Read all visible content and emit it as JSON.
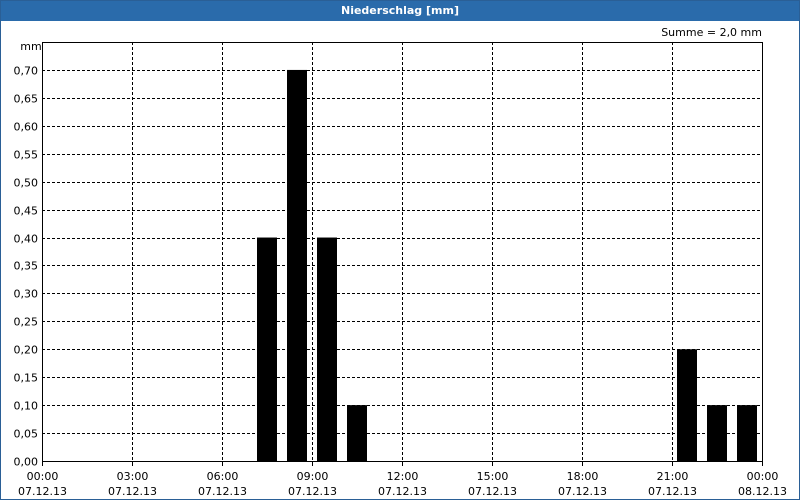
{
  "window": {
    "title": "Niederschlag [mm]"
  },
  "chart_data": {
    "type": "bar",
    "title": "Niederschlag [mm]",
    "ylabel": "mm",
    "sum_label": "Summe = 2,0 mm",
    "ylim": [
      0,
      0.75
    ],
    "y_ticks": [
      "0,00",
      "0,05",
      "0,10",
      "0,15",
      "0,20",
      "0,25",
      "0,30",
      "0,35",
      "0,40",
      "0,45",
      "0,50",
      "0,55",
      "0,60",
      "0,65",
      "0,70"
    ],
    "x_ticks": [
      {
        "time": "00:00",
        "date": "07.12.13"
      },
      {
        "time": "03:00",
        "date": "07.12.13"
      },
      {
        "time": "06:00",
        "date": "07.12.13"
      },
      {
        "time": "09:00",
        "date": "07.12.13"
      },
      {
        "time": "12:00",
        "date": "07.12.13"
      },
      {
        "time": "15:00",
        "date": "07.12.13"
      },
      {
        "time": "18:00",
        "date": "07.12.13"
      },
      {
        "time": "21:00",
        "date": "07.12.13"
      },
      {
        "time": "00:00",
        "date": "08.12.13"
      }
    ],
    "grid": true,
    "bar_color": "#000000",
    "bars": [
      {
        "hour": 7.5,
        "value": 0.4
      },
      {
        "hour": 8.5,
        "value": 0.7
      },
      {
        "hour": 9.5,
        "value": 0.4
      },
      {
        "hour": 10.5,
        "value": 0.1
      },
      {
        "hour": 21.5,
        "value": 0.2
      },
      {
        "hour": 22.5,
        "value": 0.1
      },
      {
        "hour": 23.5,
        "value": 0.1
      }
    ]
  }
}
